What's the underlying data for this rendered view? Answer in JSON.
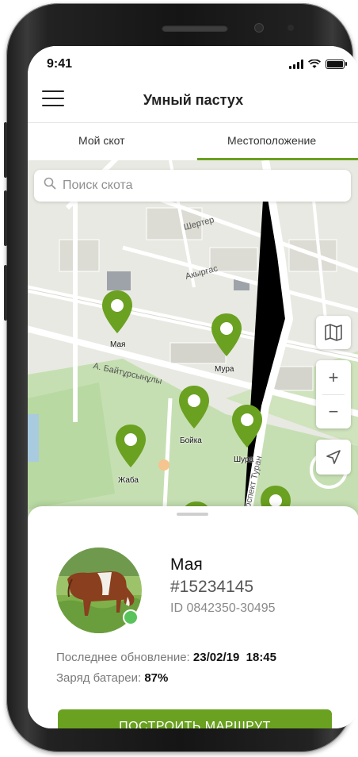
{
  "status": {
    "time": "9:41"
  },
  "header": {
    "title": "Умный пастух"
  },
  "tabs": [
    {
      "label": "Мой скот"
    },
    {
      "label": "Местоположение"
    }
  ],
  "search": {
    "placeholder": "Поиск скота"
  },
  "map": {
    "street_labels": [
      "Шертер",
      "Акырғас",
      "А. Байтұрсынұлы",
      "проспект Туран"
    ],
    "animals": [
      {
        "name": "Мая"
      },
      {
        "name": "Мура"
      },
      {
        "name": "Бойка"
      },
      {
        "name": "Шура"
      },
      {
        "name": "Жаба"
      }
    ],
    "controls": {
      "zoom_in": "+",
      "zoom_out": "−"
    }
  },
  "animal": {
    "name": "Мая",
    "number": "#15234145",
    "id": "ID 0842350-30495",
    "last_update_label": "Последнее обновление:",
    "last_update_value": "23/02/19  18:45",
    "battery_label": "Заряд батареи:",
    "battery_value": "87%"
  },
  "actions": {
    "route_label": "ПОСТРОИТЬ МАРШРУТ"
  },
  "colors": {
    "accent": "#6aa121",
    "online": "#58c35b"
  }
}
